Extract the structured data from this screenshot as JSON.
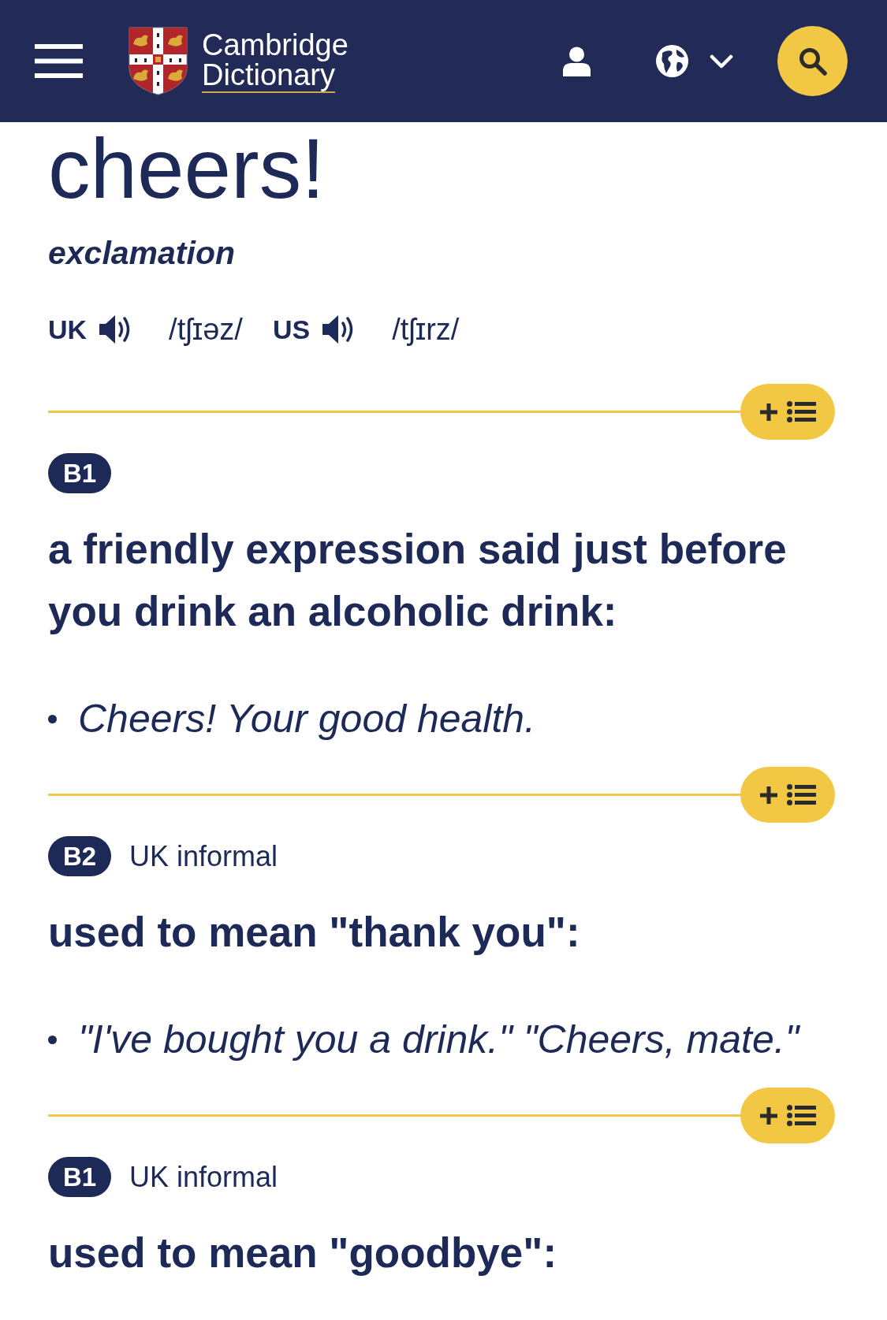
{
  "header": {
    "logo_lines": [
      "Cambridge",
      "Dictionary"
    ]
  },
  "entry": {
    "headword": "cheers!",
    "part_of_speech": "exclamation",
    "pronunciations": [
      {
        "region": "UK",
        "ipa": "/tʃɪəz/"
      },
      {
        "region": "US",
        "ipa": "/tʃɪrz/"
      }
    ]
  },
  "senses": [
    {
      "level": "B1",
      "definition": "a friendly expression said just before you drink an alcoholic drink:",
      "examples": [
        "Cheers! Your good health."
      ]
    },
    {
      "level": "B2",
      "usage": "UK informal",
      "definition": "used to mean \"thank you\":",
      "examples": [
        "\"I've bought you a drink.\" \"Cheers, mate.\""
      ]
    },
    {
      "level": "B1",
      "usage": "UK informal",
      "definition": "used to mean \"goodbye\":"
    }
  ]
}
